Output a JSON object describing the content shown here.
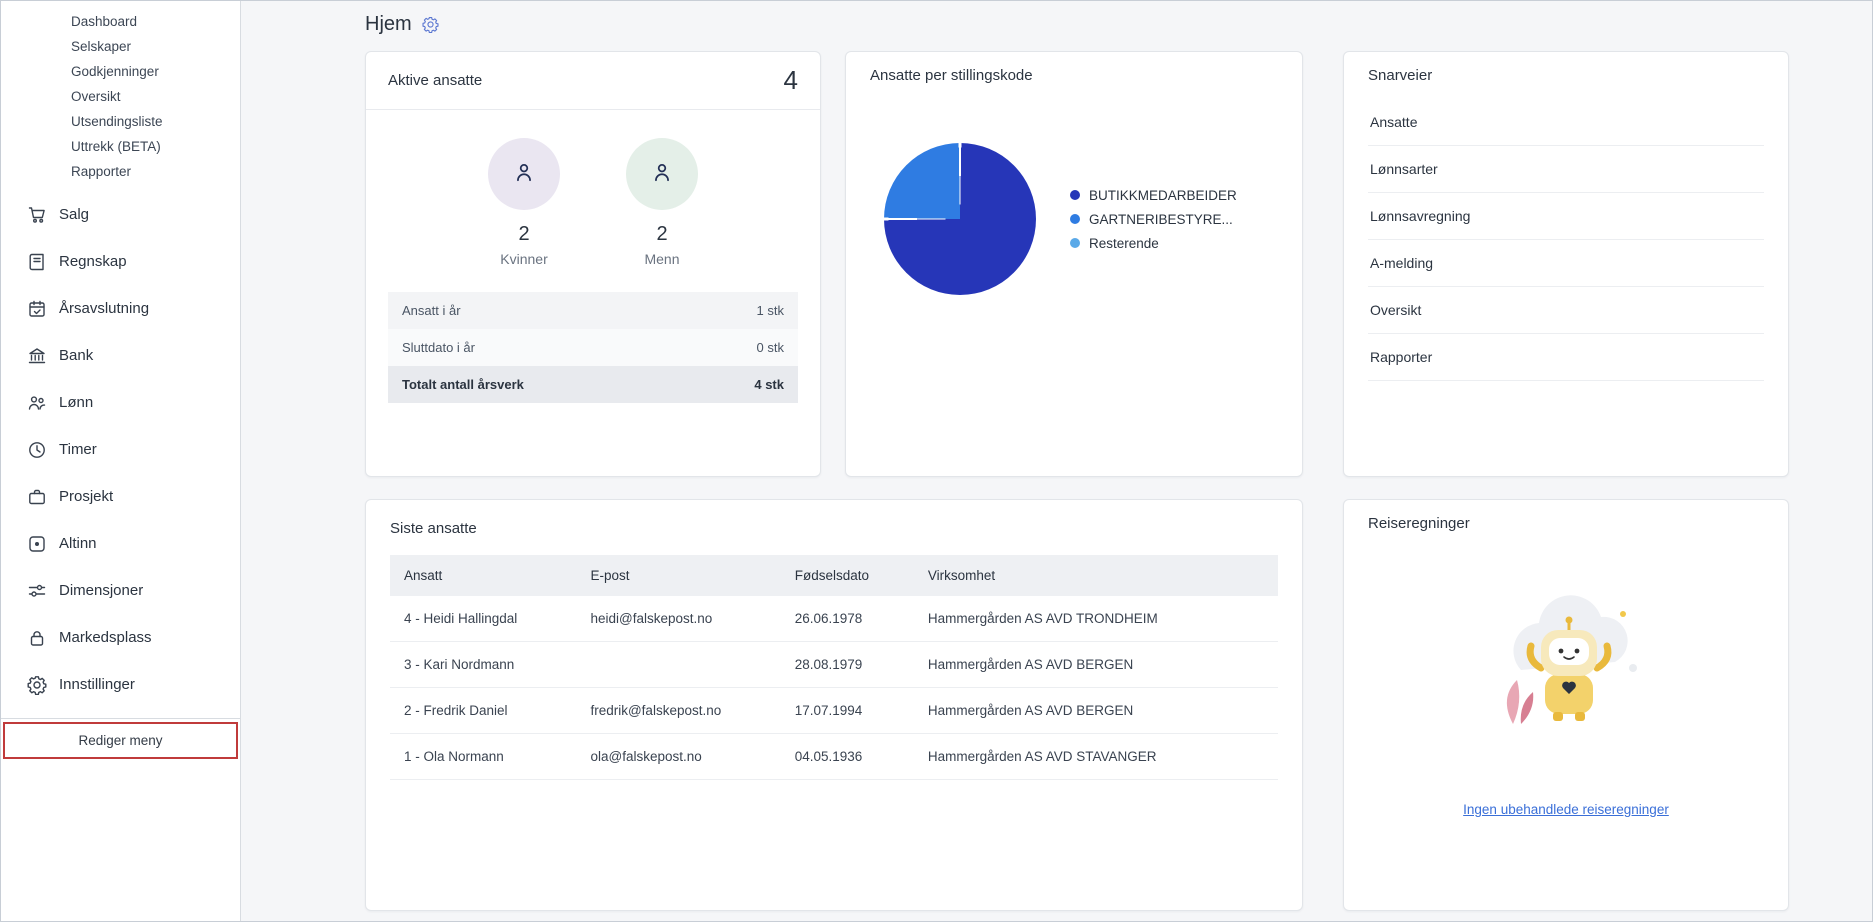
{
  "sidebar": {
    "sub_items": [
      "Dashboard",
      "Selskaper",
      "Godkjenninger",
      "Oversikt",
      "Utsendingsliste",
      "Uttrekk (BETA)",
      "Rapporter"
    ],
    "items": [
      {
        "label": "Salg",
        "icon": "cart-icon"
      },
      {
        "label": "Regnskap",
        "icon": "ledger-icon"
      },
      {
        "label": "Årsavslutning",
        "icon": "calendar-check-icon"
      },
      {
        "label": "Bank",
        "icon": "bank-icon"
      },
      {
        "label": "Lønn",
        "icon": "people-icon"
      },
      {
        "label": "Timer",
        "icon": "clock-icon"
      },
      {
        "label": "Prosjekt",
        "icon": "briefcase-icon"
      },
      {
        "label": "Altinn",
        "icon": "altinn-icon"
      },
      {
        "label": "Dimensjoner",
        "icon": "sliders-icon"
      },
      {
        "label": "Markedsplass",
        "icon": "lock-icon"
      },
      {
        "label": "Innstillinger",
        "icon": "gear-icon"
      }
    ],
    "edit_menu_label": "Rediger meny"
  },
  "header": {
    "title": "Hjem"
  },
  "cards": {
    "active_employees": {
      "title": "Aktive ansatte",
      "total": "4",
      "groups": [
        {
          "count": "2",
          "label": "Kvinner"
        },
        {
          "count": "2",
          "label": "Menn"
        }
      ],
      "rows": [
        {
          "label": "Ansatt i år",
          "value": "1 stk"
        },
        {
          "label": "Sluttdato i år",
          "value": "0 stk"
        },
        {
          "label": "Totalt antall årsverk",
          "value": "4 stk"
        }
      ]
    },
    "job_codes": {
      "title": "Ansatte per stillingskode"
    },
    "shortcuts": {
      "title": "Snarveier",
      "links": [
        "Ansatte",
        "Lønnsarter",
        "Lønnsavregning",
        "A-melding",
        "Oversikt",
        "Rapporter"
      ]
    },
    "latest_employees": {
      "title": "Siste ansatte",
      "columns": [
        "Ansatt",
        "E-post",
        "Fødselsdato",
        "Virksomhet"
      ],
      "rows": [
        [
          "4 - Heidi Hallingdal",
          "heidi@falskepost.no",
          "26.06.1978",
          "Hammergården AS AVD TRONDHEIM"
        ],
        [
          "3 - Kari Nordmann",
          "",
          "28.08.1979",
          "Hammergården AS AVD BERGEN"
        ],
        [
          "2 - Fredrik Daniel",
          "fredrik@falskepost.no",
          "17.07.1994",
          "Hammergården AS AVD BERGEN"
        ],
        [
          "1 - Ola Normann",
          "ola@falskepost.no",
          "04.05.1936",
          "Hammergården AS AVD STAVANGER"
        ]
      ]
    },
    "travel_expenses": {
      "title": "Reiseregninger",
      "empty_link": "Ingen ubehandlede reiseregninger"
    }
  },
  "chart_data": {
    "type": "pie",
    "title": "Ansatte per stillingskode",
    "labels": [
      "BUTIKKMEDARBEIDER",
      "GARTNERIBESTYRE...",
      "Resterende"
    ],
    "values": [
      3,
      1,
      0
    ],
    "colors": [
      "#2636b8",
      "#2f7ce2",
      "#5aa9e8"
    ],
    "legend_position": "right"
  },
  "colors": {
    "accent_red": "#c03b3b",
    "link_blue": "#3a6fd8",
    "background": "#f5f6f8"
  }
}
